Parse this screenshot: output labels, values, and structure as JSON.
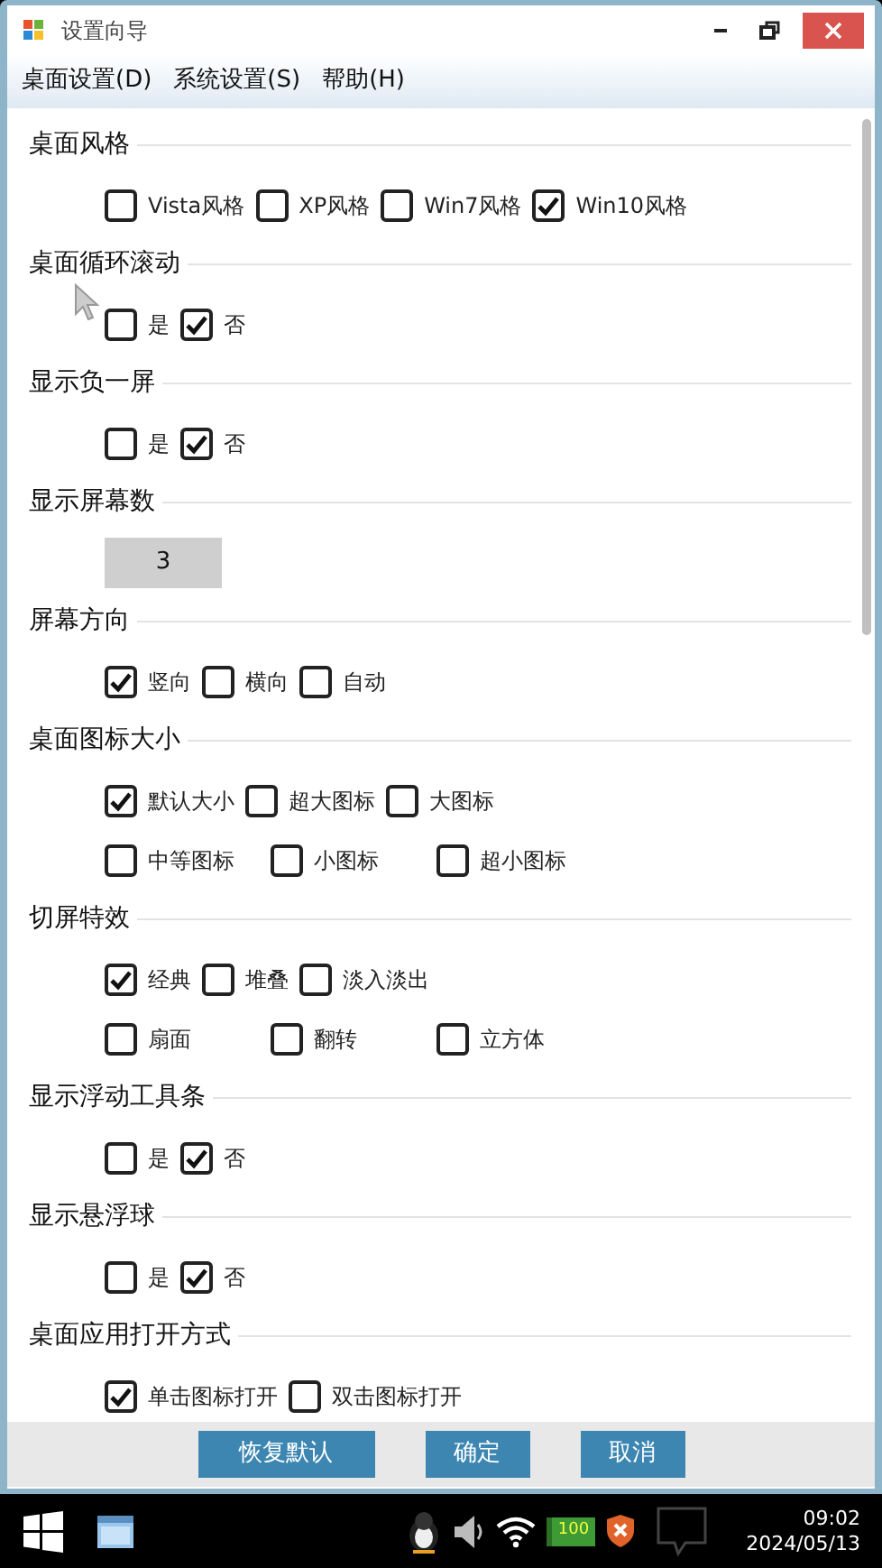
{
  "window": {
    "title": "设置向导"
  },
  "menu": [
    {
      "label": "桌面设置(D)"
    },
    {
      "label": "系统设置(S)"
    },
    {
      "label": "帮助(H)"
    }
  ],
  "sections": [
    {
      "title": "桌面风格",
      "kind": "options",
      "rows": [
        [
          {
            "label": "Vista风格",
            "checked": false
          },
          {
            "label": "XP风格",
            "checked": false
          },
          {
            "label": "Win7风格",
            "checked": false
          },
          {
            "label": "Win10风格",
            "checked": true
          }
        ]
      ]
    },
    {
      "title": "桌面循环滚动",
      "kind": "options",
      "rows": [
        [
          {
            "label": "是",
            "checked": false
          },
          {
            "label": "否",
            "checked": true
          }
        ]
      ]
    },
    {
      "title": "显示负一屏",
      "kind": "options",
      "rows": [
        [
          {
            "label": "是",
            "checked": false
          },
          {
            "label": "否",
            "checked": true
          }
        ]
      ]
    },
    {
      "title": "显示屏幕数",
      "kind": "number",
      "value": "3"
    },
    {
      "title": "屏幕方向",
      "kind": "options",
      "rows": [
        [
          {
            "label": "竖向",
            "checked": true
          },
          {
            "label": "横向",
            "checked": false
          },
          {
            "label": "自动",
            "checked": false
          }
        ]
      ]
    },
    {
      "title": "桌面图标大小",
      "kind": "options",
      "rows": [
        [
          {
            "label": "默认大小",
            "checked": true
          },
          {
            "label": "超大图标",
            "checked": false
          },
          {
            "label": "大图标",
            "checked": false
          }
        ],
        [
          {
            "label": "中等图标",
            "checked": false
          },
          {
            "label": "小图标",
            "checked": false
          },
          {
            "label": "超小图标",
            "checked": false
          }
        ]
      ]
    },
    {
      "title": "切屏特效",
      "kind": "options",
      "rows": [
        [
          {
            "label": "经典",
            "checked": true
          },
          {
            "label": "堆叠",
            "checked": false
          },
          {
            "label": "淡入淡出",
            "checked": false
          }
        ],
        [
          {
            "label": "扇面",
            "checked": false
          },
          {
            "label": "翻转",
            "checked": false
          },
          {
            "label": "立方体",
            "checked": false
          }
        ]
      ]
    },
    {
      "title": "显示浮动工具条",
      "kind": "options",
      "rows": [
        [
          {
            "label": "是",
            "checked": false
          },
          {
            "label": "否",
            "checked": true
          }
        ]
      ]
    },
    {
      "title": "显示悬浮球",
      "kind": "options",
      "rows": [
        [
          {
            "label": "是",
            "checked": false
          },
          {
            "label": "否",
            "checked": true
          }
        ]
      ]
    },
    {
      "title": "桌面应用打开方式",
      "kind": "options",
      "rows": [
        [
          {
            "label": "单击图标打开",
            "checked": true
          },
          {
            "label": "双击图标打开",
            "checked": false
          }
        ]
      ]
    }
  ],
  "buttons": [
    {
      "label": "恢复默认"
    },
    {
      "label": "确定"
    },
    {
      "label": "取消"
    }
  ],
  "taskbar": {
    "battery": "100",
    "time": "09:02",
    "date": "2024/05/13"
  }
}
